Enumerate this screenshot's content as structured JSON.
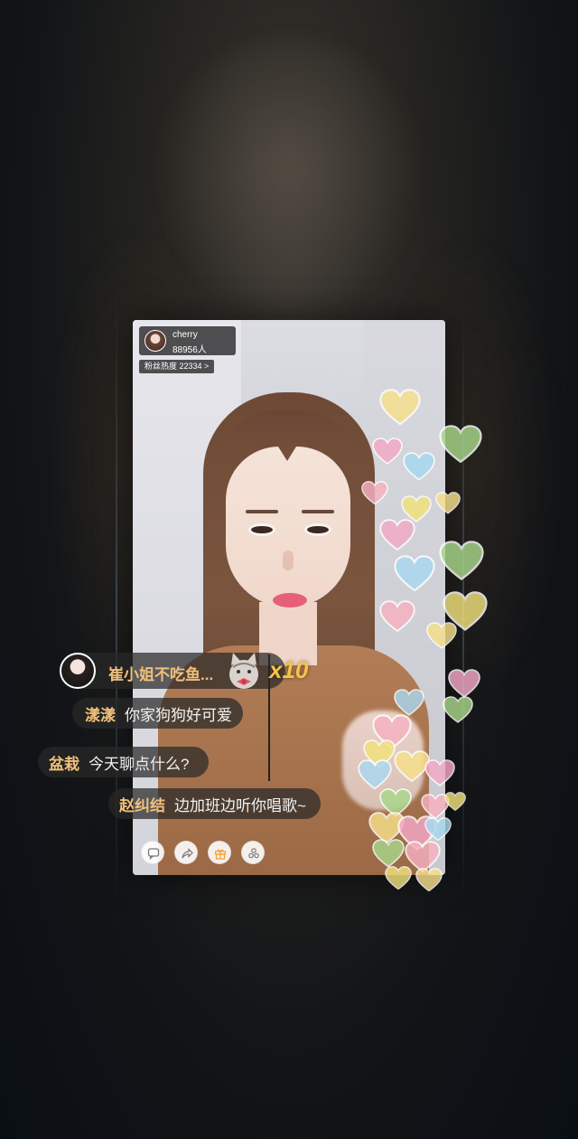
{
  "anchor": {
    "name": "cherry",
    "viewers": "88956人"
  },
  "fans": {
    "label": "粉丝热度 22334 >"
  },
  "gift": {
    "user": "崔小姐不吃鱼...",
    "count": "x10",
    "icon": "cat-gift-icon"
  },
  "chat": [
    {
      "user": "漾漾",
      "text": "你家狗狗好可爱"
    },
    {
      "user": "盆栽",
      "text": "今天聊点什么?"
    },
    {
      "user": "赵纠结",
      "text": "边加班边听你唱歌~"
    }
  ],
  "toolbar": {
    "items": [
      {
        "icon": "chat-icon"
      },
      {
        "icon": "share-icon"
      },
      {
        "icon": "gift-icon",
        "color": "#f0a030"
      },
      {
        "icon": "more-icon"
      }
    ]
  },
  "colors": {
    "username": "#f0c07a",
    "gift_count": "#f6c447",
    "hearts": [
      "#f7e08a",
      "#f4a9c6",
      "#a8d8f0",
      "#a8d88a",
      "#f7b1c1",
      "#f2e27c"
    ]
  }
}
